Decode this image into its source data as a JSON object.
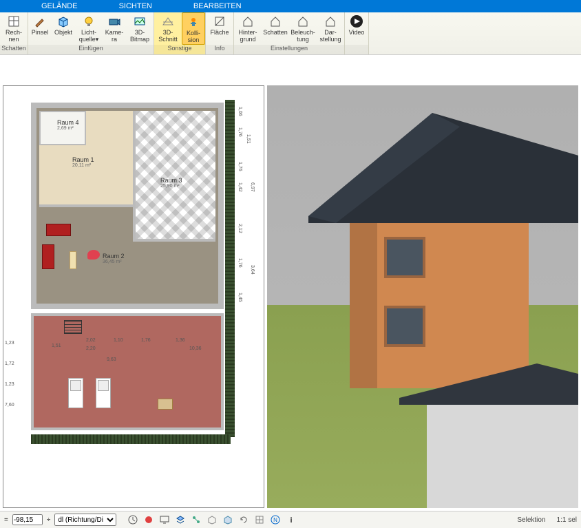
{
  "menu": {
    "gelaende": "GELÄNDE",
    "sichten": "SICHTEN",
    "bearbeiten": "BEARBEITEN"
  },
  "ribbon": {
    "groups": [
      {
        "label": "Schatten",
        "items": [
          {
            "name": "rechnen",
            "label": "Rech-\nnen",
            "icon": "calc"
          }
        ]
      },
      {
        "label": "Einfügen",
        "items": [
          {
            "name": "pinsel",
            "label": "Pinsel",
            "icon": "brush"
          },
          {
            "name": "objekt",
            "label": "Objekt",
            "icon": "cube"
          },
          {
            "name": "lichtquelle",
            "label": "Licht-\nquelle▾",
            "icon": "bulb"
          },
          {
            "name": "kamera",
            "label": "Kame-\nra",
            "icon": "camera"
          },
          {
            "name": "3d-bitmap",
            "label": "3D-\nBitmap",
            "icon": "bitmap"
          }
        ]
      },
      {
        "label": "Sonstige",
        "items": [
          {
            "name": "3d-schnitt",
            "label": "3D-\nSchnitt",
            "icon": "section"
          },
          {
            "name": "kollision",
            "label": "Kolli-\nsion",
            "icon": "collision",
            "selected": true
          }
        ],
        "yellow": true
      },
      {
        "label": "Info",
        "items": [
          {
            "name": "flaeche",
            "label": "Fläche",
            "icon": "area"
          }
        ]
      },
      {
        "label": "Einstellungen",
        "items": [
          {
            "name": "hintergrund",
            "label": "Hinter-\ngrund",
            "icon": "house"
          },
          {
            "name": "schatten-einst",
            "label": "Schatten",
            "icon": "house"
          },
          {
            "name": "beleuchtung",
            "label": "Beleuch-\ntung",
            "icon": "house"
          },
          {
            "name": "darstellung",
            "label": "Dar-\nstellung",
            "icon": "house"
          }
        ]
      },
      {
        "label": "",
        "items": [
          {
            "name": "video",
            "label": "Video",
            "icon": "play"
          }
        ]
      }
    ]
  },
  "plan": {
    "rooms": {
      "r1": {
        "name": "Raum 1",
        "size": "20,11 m²"
      },
      "r2": {
        "name": "Raum 2",
        "size": "36,45 m²"
      },
      "r3": {
        "name": "Raum 3",
        "size": "25,90 m²"
      },
      "r4": {
        "name": "Raum 4",
        "size": "2,69 m²"
      }
    },
    "dims": {
      "right_a": "1,06",
      "right_b": "1,76",
      "right_c": "1,51",
      "right_d": "1,76",
      "right_e": "1,42",
      "right_f": "6,97",
      "right_g": "2,12",
      "right_h": "1,76",
      "right_i": "3,64",
      "right_j": "1,45",
      "left_a": "1,23",
      "left_b": "1,72",
      "left_c": "1,23",
      "left_d": "7,60",
      "terr_a": "1,51",
      "terr_b": "2,02",
      "terr_c": "2,20",
      "terr_d": "1,10",
      "terr_e": "1,76",
      "terr_f": "1,36",
      "terr_g": "10,36",
      "terr_total": "9,63"
    }
  },
  "status": {
    "coord_label": "=",
    "coord_value": "-98,15",
    "direction_label": "dl (Richtung/Di",
    "selektion": "Selektion",
    "ratio": "1:1 sel"
  }
}
